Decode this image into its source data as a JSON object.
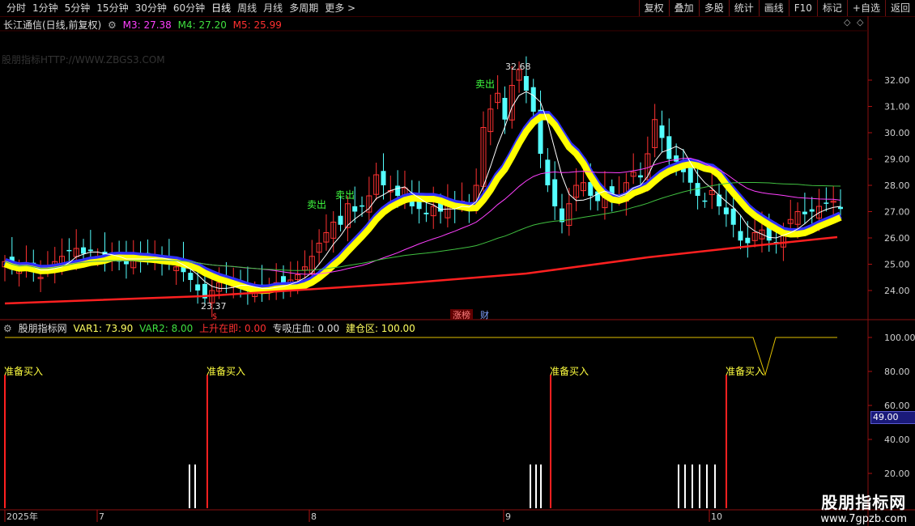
{
  "toolbar": {
    "tabs": [
      "分时",
      "1分钟",
      "5分钟",
      "15分钟",
      "30分钟",
      "60分钟",
      "日线",
      "周线",
      "月线",
      "多周期",
      "更多 >"
    ],
    "active_tab": "日线",
    "right_buttons": [
      "复权",
      "叠加",
      "多股",
      "统计",
      "画线",
      "F10",
      "标记",
      "+自选",
      "返回"
    ]
  },
  "main_info": {
    "stock": "长江通信(日线,前复权)",
    "m3": "M3: 27.38",
    "m4": "M4: 27.20",
    "m5": "M5: 25.99"
  },
  "watermark": "股朋指标HTTP://WWW.ZBGS3.COM",
  "annotations": {
    "high": "32.68",
    "low": "23.37",
    "sell": "卖出",
    "zhangting": "涨榜",
    "cai": "财",
    "dollar": "$"
  },
  "price_axis": {
    "ticks": [
      "32.00",
      "31.00",
      "30.00",
      "29.00",
      "28.00",
      "27.00",
      "26.00",
      "25.00",
      "24.00"
    ]
  },
  "indicator_info": {
    "name": "股朋指标网",
    "var1": "VAR1: 73.90",
    "var2": "VAR2: 8.00",
    "rise": "上升在即: 0.00",
    "absorb": "专吸庄血: 0.00",
    "build": "建仓区: 100.00"
  },
  "indicator_axis": {
    "ticks": [
      "100.00",
      "80.00",
      "60.00",
      "40.00",
      "20.00"
    ],
    "current": "49.00"
  },
  "signals": {
    "label": "准备买入"
  },
  "date_axis": {
    "labels": [
      "2025年",
      "7",
      "8",
      "9",
      "10"
    ]
  },
  "brand": {
    "line1": "股朋指标网",
    "line2": "www.7gpzb.com"
  },
  "colors": {
    "up": "#ff3232",
    "down": "#54ffff",
    "ma_yellow": "#ffff00",
    "ma_red": "#ff2020",
    "ma_magenta": "#ff40ff",
    "ma_green": "#40c040"
  }
}
